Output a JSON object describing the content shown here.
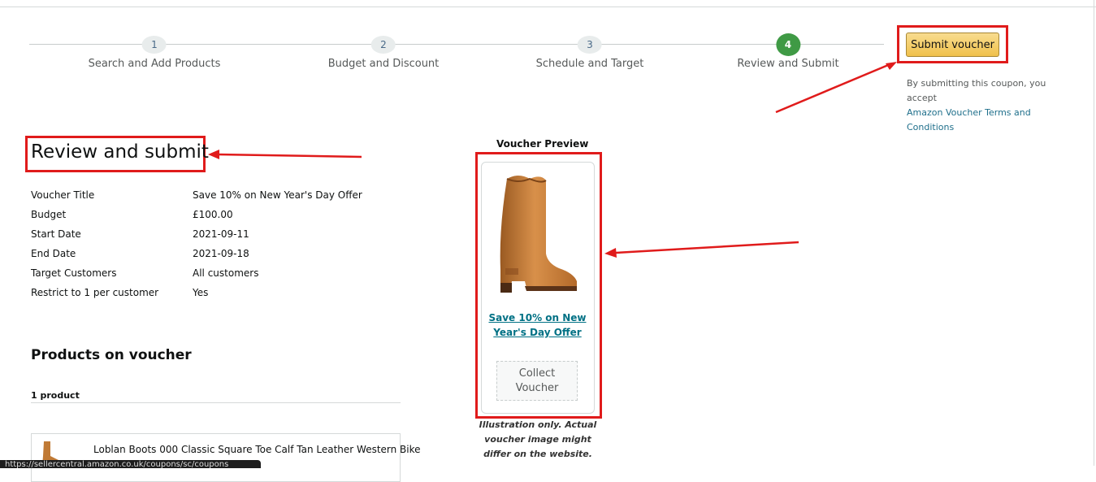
{
  "stepper": {
    "steps": [
      {
        "number": "1",
        "label": "Search and Add Products"
      },
      {
        "number": "2",
        "label": "Budget and Discount"
      },
      {
        "number": "3",
        "label": "Schedule and Target"
      },
      {
        "number": "4",
        "label": "Review and Submit"
      }
    ],
    "active_step": 4
  },
  "submit": {
    "button_label": "Submit voucher",
    "terms_prefix": "By submitting this coupon, you accept",
    "terms_link": "Amazon Voucher Terms and Conditions"
  },
  "page": {
    "title": "Review and submit"
  },
  "details": [
    {
      "label": "Voucher Title",
      "value": "Save 10% on New Year's Day Offer"
    },
    {
      "label": "Budget",
      "value": "£100.00"
    },
    {
      "label": "Start Date",
      "value": "2021-09-11"
    },
    {
      "label": "End Date",
      "value": "2021-09-18"
    },
    {
      "label": "Target Customers",
      "value": "All customers"
    },
    {
      "label": "Restrict to 1 per customer",
      "value": "Yes"
    }
  ],
  "products": {
    "heading": "Products on voucher",
    "count": "1 product",
    "items": [
      {
        "name": "Loblan Boots 000 Classic Square Toe Calf Tan Leather Western Bike"
      }
    ]
  },
  "preview": {
    "heading": "Voucher Preview",
    "voucher_title": "Save 10% on New Year's Day Offer",
    "collect_label": "Collect Voucher",
    "note": "Illustration only. Actual voucher image might differ on the website."
  },
  "status_bar": {
    "text": "https://sellercentral.amazon.co.uk/coupons/sc/coupons"
  },
  "colors": {
    "annotation_red": "#e01b1b",
    "active_step_green": "#3f9a45",
    "button_yellow": "#f0c14b",
    "link_teal": "#007185"
  }
}
